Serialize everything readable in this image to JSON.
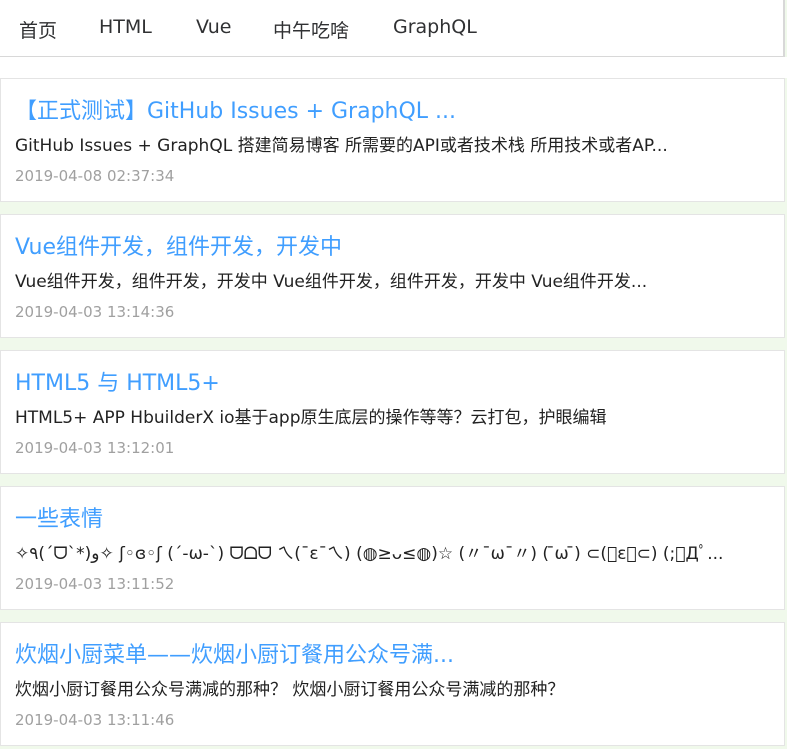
{
  "nav": {
    "items": [
      "首页",
      "HTML",
      "Vue",
      "中午吃啥",
      "GraphQL"
    ]
  },
  "posts": [
    {
      "title": "【正式测试】GitHub Issues + GraphQL ...",
      "summary": "GitHub Issues + GraphQL 搭建简易博客 所需要的API或者技术栈 所用技术或者AP...",
      "date": "2019-04-08 02:37:34"
    },
    {
      "title": "Vue组件开发，组件开发，开发中",
      "summary": "Vue组件开发，组件开发，开发中 Vue组件开发，组件开发，开发中 Vue组件开发...",
      "date": "2019-04-03 13:14:36"
    },
    {
      "title": "HTML5 与 HTML5+",
      "summary": "HTML5+ APP HbuilderX io基于app原生底层的操作等等？云打包，护眼编辑",
      "date": "2019-04-03 13:12:01"
    },
    {
      "title": "一些表情",
      "summary": "✧٩(ˊᗜˋ*)و✧ ʃ◦ɞ◦ʃ (´-ω-`) ᗜᗝᗜ ㄟ(¯ε¯ㄟ) (◍≥ᴗ≤◍)☆ (〃¯ω¯〃) ( ̄ω ̄) ⊂(゚ε゚⊂) (;ﾟДﾟ...",
      "date": "2019-04-03 13:11:52"
    },
    {
      "title": "炊烟小厨菜单——炊烟小厨订餐用公众号满...",
      "summary": "炊烟小厨订餐用公众号满减的那种？ 炊烟小厨订餐用公众号满减的那种？",
      "date": "2019-04-03 13:11:46"
    }
  ]
}
